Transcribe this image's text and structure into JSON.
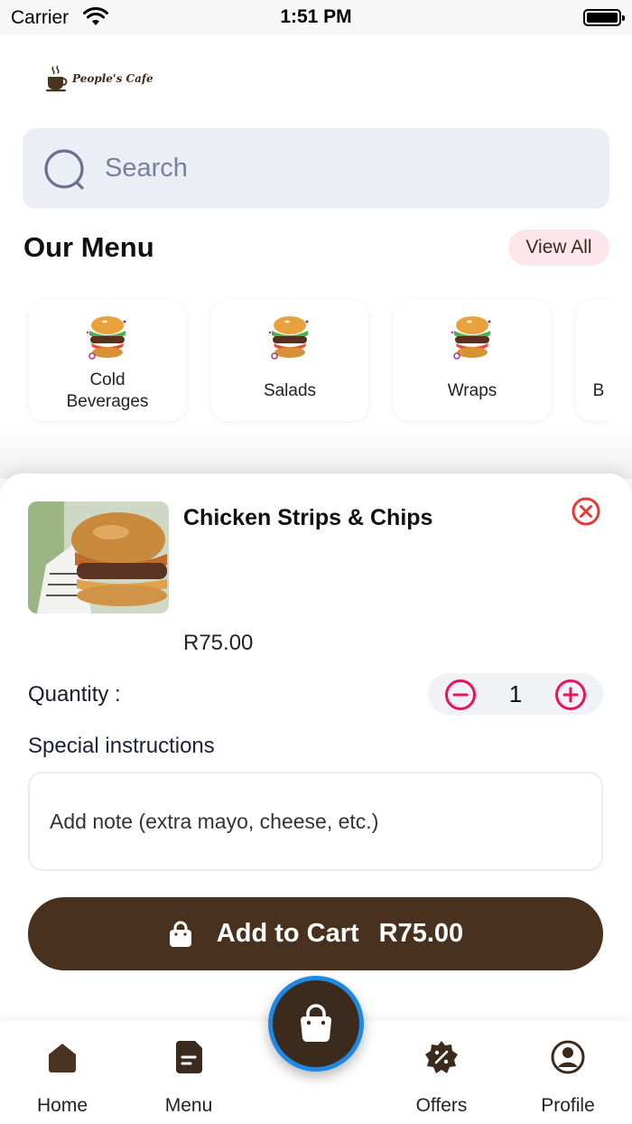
{
  "status_bar": {
    "carrier": "Carrier",
    "time": "1:51 PM"
  },
  "brand": {
    "name": "People's Cafe"
  },
  "search": {
    "placeholder": "Search",
    "icon": "search-icon"
  },
  "menu_section": {
    "title": "Our Menu",
    "view_all_label": "View All",
    "categories": [
      {
        "label_line1": "Cold",
        "label_line2": "Beverages",
        "icon": "burger-image"
      },
      {
        "label_line1": "Salads",
        "icon": "burger-image"
      },
      {
        "label_line1": "Wraps",
        "icon": "burger-image"
      },
      {
        "label_line1": "B",
        "icon": "burger-image"
      }
    ]
  },
  "product_sheet": {
    "name": "Chicken Strips & Chips",
    "price": "R75.00",
    "quantity_label": "Quantity :",
    "quantity": "1",
    "special_instructions_label": "Special instructions",
    "note_placeholder": "Add note (extra mayo, cheese, etc.)",
    "cart_button_label": "Add to Cart",
    "cart_button_amount": "R75.00"
  },
  "bottom_nav": {
    "items": [
      {
        "label": "Home",
        "icon": "home-icon"
      },
      {
        "label": "Menu",
        "icon": "menu-icon"
      },
      {
        "label": "Offers",
        "icon": "offers-icon"
      },
      {
        "label": "Profile",
        "icon": "profile-icon"
      }
    ],
    "center_button_icon": "shopping-bag-icon"
  },
  "colors": {
    "accent_pink": "#e8135d",
    "brand_brown": "#48311f",
    "close_red": "#e53935",
    "fab_ring": "#1e88e5",
    "search_bg": "#eceef5"
  }
}
